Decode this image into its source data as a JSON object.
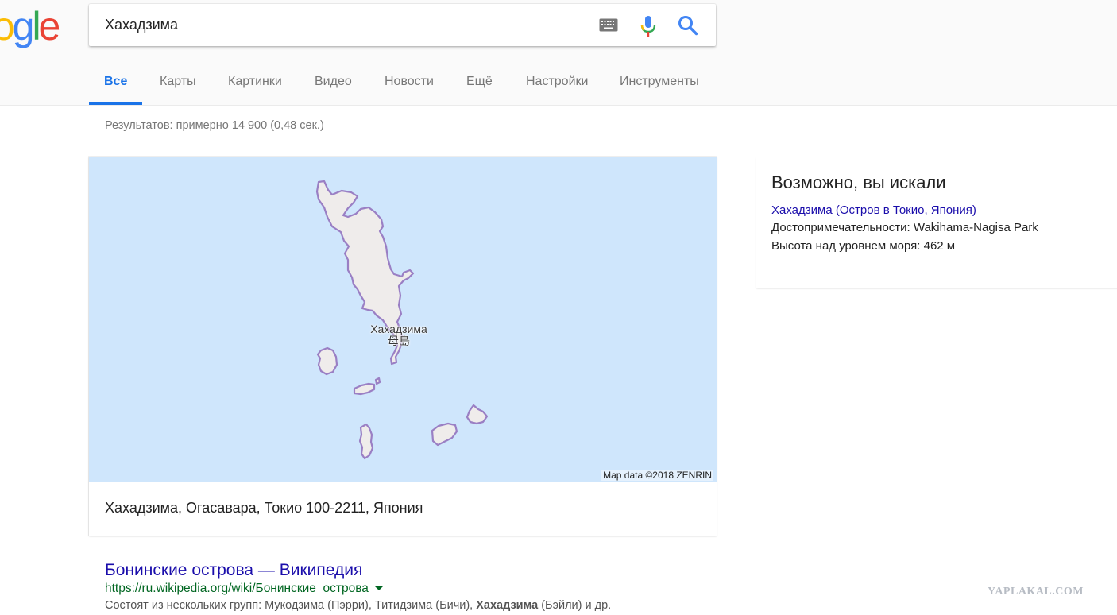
{
  "logo": {
    "text": "oogle",
    "letters": [
      "o",
      "o",
      "g",
      "l",
      "e"
    ],
    "colors": [
      "#ea4335",
      "#fbbc05",
      "#4285f4",
      "#34a853",
      "#ea4335"
    ]
  },
  "search": {
    "query": "Хахадзима"
  },
  "icons": {
    "keyboard": "keyboard-icon",
    "mic": "mic-icon",
    "search": "search-icon"
  },
  "tabs": [
    {
      "label": "Все",
      "active": true
    },
    {
      "label": "Карты",
      "active": false
    },
    {
      "label": "Картинки",
      "active": false
    },
    {
      "label": "Видео",
      "active": false
    },
    {
      "label": "Новости",
      "active": false
    },
    {
      "label": "Ещё",
      "active": false
    },
    {
      "label": "Настройки",
      "active": false
    },
    {
      "label": "Инструменты",
      "active": false
    }
  ],
  "stats": "Результатов: примерно 14 900 (0,48 сек.)",
  "map": {
    "label_ru": "Хахадзима",
    "label_jp": "母島",
    "attribution": "Map data ©2018 ZENRIN",
    "address": "Хахадзима, Огасавара, Токио 100-2211, Япония"
  },
  "knowledge_panel": {
    "title": "Возможно, вы искали",
    "link": "Хахадзима (Остров в Токио, Япония)",
    "line1": "Достопримечательности: Wakihama-Nagisa Park",
    "line2": "Высота над уровнем моря: 462 м"
  },
  "result": {
    "title": "Бонинские острова — Википедия",
    "url": "https://ru.wikipedia.org/wiki/Бонинские_острова",
    "snippet_start": "Состоят из нескольких групп: Мукодзима (Пэрри), Титидзима (Бичи), ",
    "snippet_bold": "Хахадзима",
    "snippet_end": " (Бэйли) и др."
  },
  "watermark": "YAPLAKAL.COM",
  "colors": {
    "accent": "#1a73e8",
    "link": "#1a0dab",
    "url": "#006621",
    "water": "#cfe6fc",
    "land": "#efeceb",
    "land_border": "#9a7fc4"
  }
}
